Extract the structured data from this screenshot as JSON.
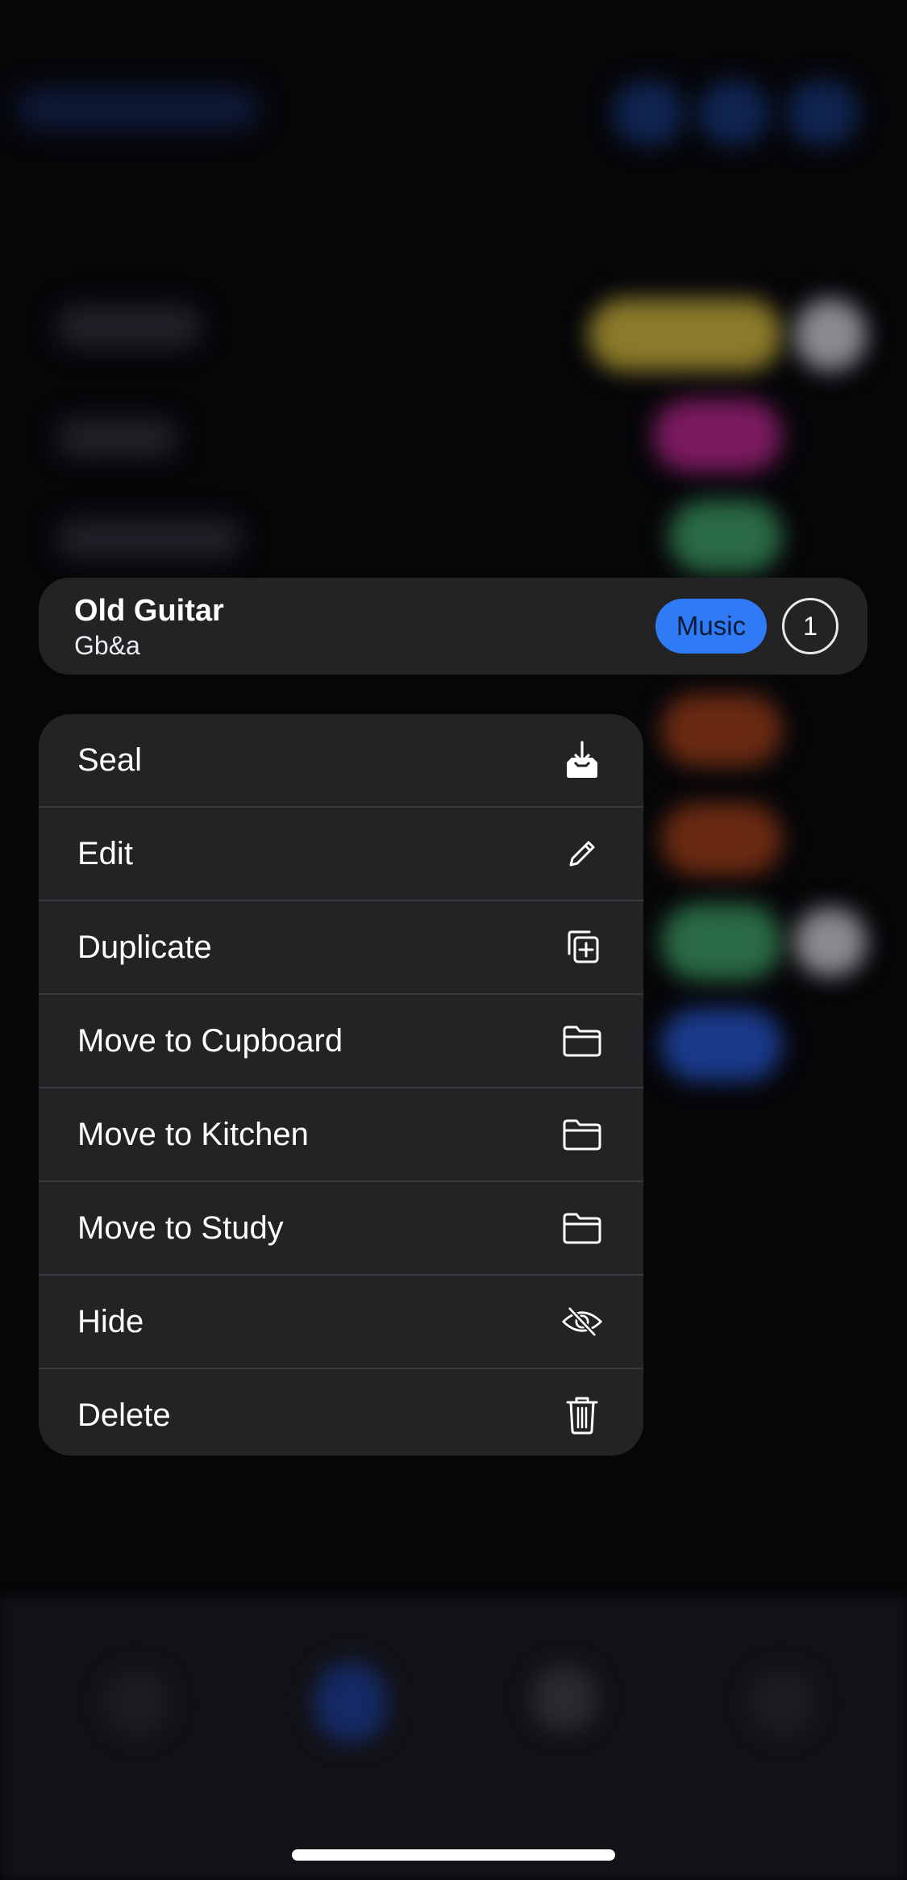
{
  "item": {
    "title": "Old Guitar",
    "subtitle": "Gb&a",
    "tag": "Music",
    "count": "1"
  },
  "menu": {
    "items": [
      {
        "label": "Seal",
        "icon": "tray-download-icon"
      },
      {
        "label": "Edit",
        "icon": "pencil-icon"
      },
      {
        "label": "Duplicate",
        "icon": "duplicate-plus-icon"
      },
      {
        "label": "Move to Cupboard",
        "icon": "folder-icon"
      },
      {
        "label": "Move to Kitchen",
        "icon": "folder-icon"
      },
      {
        "label": "Move to Study",
        "icon": "folder-icon"
      },
      {
        "label": "Hide",
        "icon": "eye-slash-icon"
      },
      {
        "label": "Delete",
        "icon": "trash-icon"
      }
    ]
  },
  "colors": {
    "accent": "#2f7bf6",
    "menu_background": "#232326",
    "background": "#060609"
  }
}
